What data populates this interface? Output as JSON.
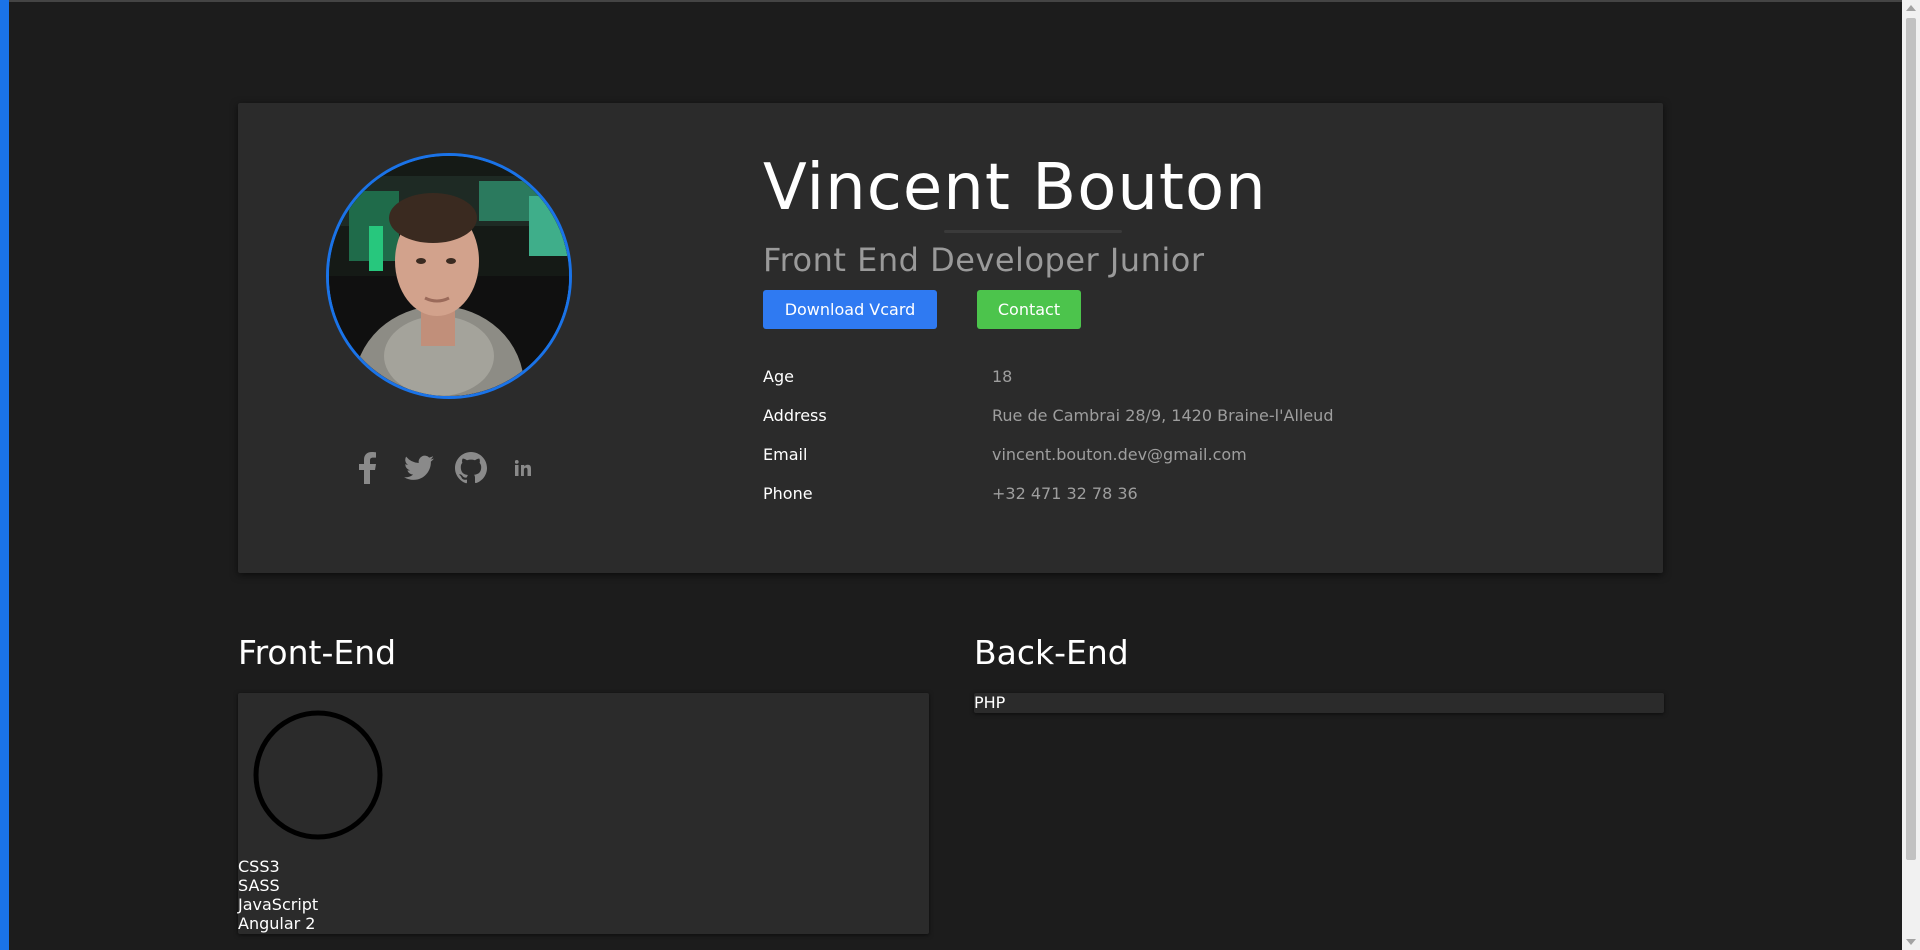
{
  "profile": {
    "name": "Vincent Bouton",
    "title": "Front End Developer Junior",
    "buttons": {
      "download": "Download Vcard",
      "contact": "Contact"
    },
    "info": [
      {
        "label": "Age",
        "value": "18"
      },
      {
        "label": "Address",
        "value": "Rue de Cambrai 28/9, 1420 Braine-l'Alleud"
      },
      {
        "label": "Email",
        "value": "vincent.bouton.dev@gmail.com"
      },
      {
        "label": "Phone",
        "value": "+32 471 32 78 36"
      }
    ],
    "socials": [
      "facebook-icon",
      "twitter-icon",
      "github-icon",
      "linkedin-icon"
    ]
  },
  "sections": {
    "front": {
      "title": "Front-End",
      "skills": [
        "CSS3",
        "SASS",
        "JavaScript",
        "Angular 2"
      ]
    },
    "back": {
      "title": "Back-End",
      "skills": [
        "PHP"
      ]
    }
  },
  "colors": {
    "background": "#1c1c1c",
    "card": "#2b2b2b",
    "accent_blue": "#2f7af2",
    "accent_green": "#4cc44c",
    "avatar_border": "#1a73e8",
    "muted_text": "#9e9e9e"
  }
}
